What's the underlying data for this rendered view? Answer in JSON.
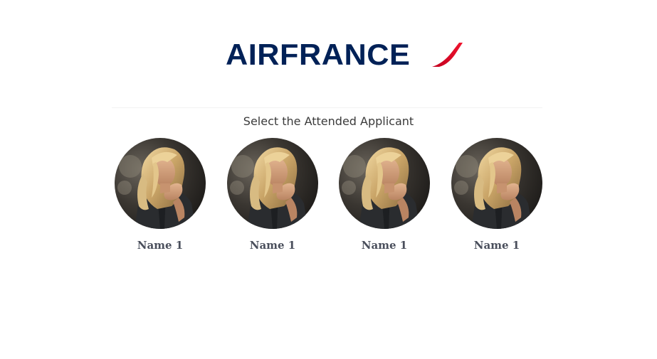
{
  "brand": {
    "logo_text": "AIRFRANCE",
    "logo_color": "#002157",
    "swoosh_color": "#e4002b"
  },
  "header": {
    "subtitle": "Select the Attended Applicant"
  },
  "applicants": [
    {
      "name": "Name 1"
    },
    {
      "name": "Name 1"
    },
    {
      "name": "Name 1"
    },
    {
      "name": "Name 1"
    }
  ]
}
